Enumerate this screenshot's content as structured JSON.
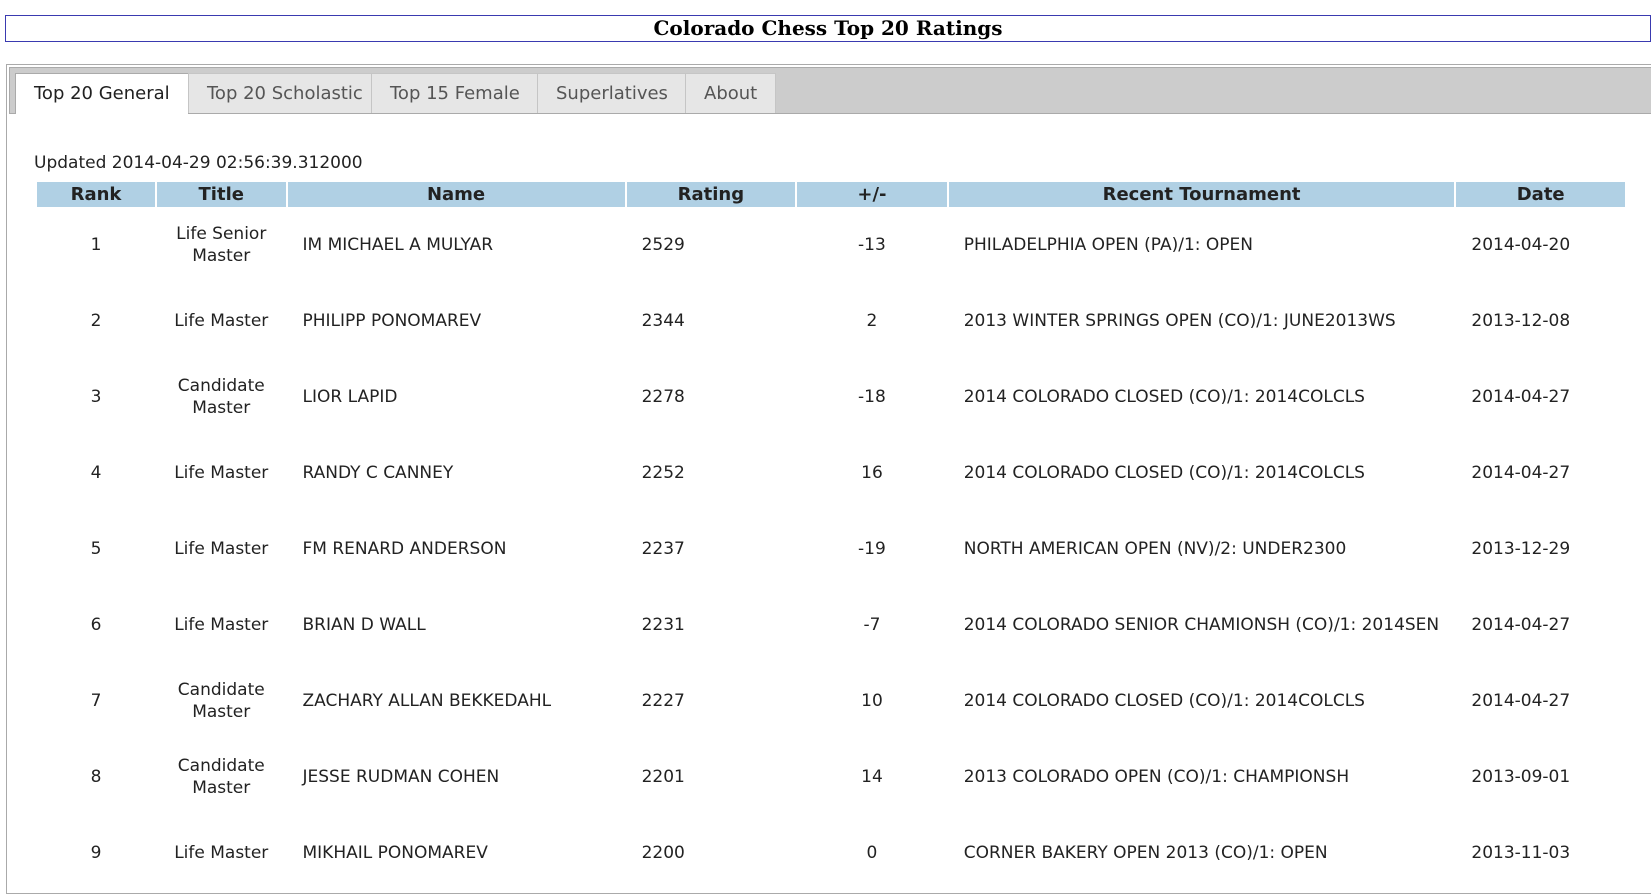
{
  "page_title": "Colorado Chess Top 20 Ratings",
  "tabs": [
    {
      "label": "Top 20 General",
      "active": true
    },
    {
      "label": "Top 20 Scholastic",
      "active": false
    },
    {
      "label": "Top 15 Female",
      "active": false
    },
    {
      "label": "Superlatives",
      "active": false
    },
    {
      "label": "About",
      "active": false
    }
  ],
  "updated": "Updated 2014-04-29 02:56:39.312000",
  "table": {
    "headers": [
      "Rank",
      "Title",
      "Name",
      "Rating",
      "+/-",
      "Recent Tournament",
      "Date"
    ],
    "rows": [
      {
        "rank": "1",
        "title": "Life Senior Master",
        "name": "IM MICHAEL A MULYAR",
        "rating": "2529",
        "change": "-13",
        "tournament": "PHILADELPHIA OPEN (PA)/1: OPEN",
        "date": "2014-04-20"
      },
      {
        "rank": "2",
        "title": "Life Master",
        "name": "PHILIPP PONOMAREV",
        "rating": "2344",
        "change": "2",
        "tournament": "2013 WINTER SPRINGS OPEN (CO)/1: JUNE2013WS",
        "date": "2013-12-08"
      },
      {
        "rank": "3",
        "title": "Candidate Master",
        "name": "LIOR LAPID",
        "rating": "2278",
        "change": "-18",
        "tournament": "2014 COLORADO CLOSED (CO)/1: 2014COLCLS",
        "date": "2014-04-27"
      },
      {
        "rank": "4",
        "title": "Life Master",
        "name": "RANDY C CANNEY",
        "rating": "2252",
        "change": "16",
        "tournament": "2014 COLORADO CLOSED (CO)/1: 2014COLCLS",
        "date": "2014-04-27"
      },
      {
        "rank": "5",
        "title": "Life Master",
        "name": "FM RENARD ANDERSON",
        "rating": "2237",
        "change": "-19",
        "tournament": "NORTH AMERICAN OPEN (NV)/2: UNDER2300",
        "date": "2013-12-29"
      },
      {
        "rank": "6",
        "title": "Life Master",
        "name": "BRIAN D WALL",
        "rating": "2231",
        "change": "-7",
        "tournament": "2014 COLORADO SENIOR CHAMIONSH (CO)/1: 2014SEN",
        "date": "2014-04-27"
      },
      {
        "rank": "7",
        "title": "Candidate Master",
        "name": "ZACHARY ALLAN BEKKEDAHL",
        "rating": "2227",
        "change": "10",
        "tournament": "2014 COLORADO CLOSED (CO)/1: 2014COLCLS",
        "date": "2014-04-27"
      },
      {
        "rank": "8",
        "title": "Candidate Master",
        "name": "JESSE RUDMAN COHEN",
        "rating": "2201",
        "change": "14",
        "tournament": "2013 COLORADO OPEN (CO)/1: CHAMPIONSH",
        "date": "2013-09-01"
      },
      {
        "rank": "9",
        "title": "Life Master",
        "name": "MIKHAIL PONOMAREV",
        "rating": "2200",
        "change": "0",
        "tournament": "CORNER BAKERY OPEN 2013 (CO)/1: OPEN",
        "date": "2013-11-03"
      }
    ]
  }
}
